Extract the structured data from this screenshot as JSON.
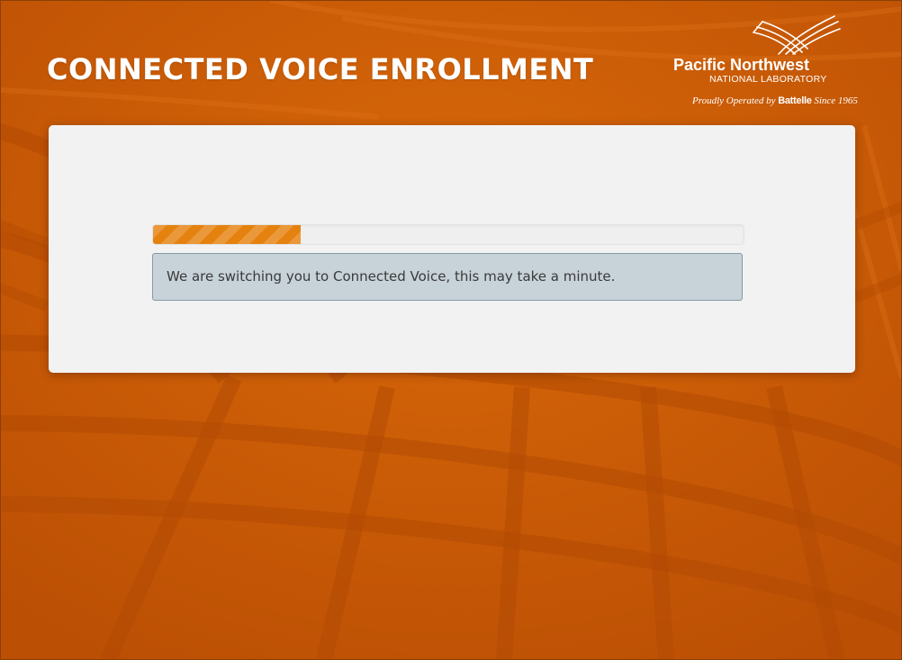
{
  "header": {
    "title": "CONNECTED VOICE ENROLLMENT"
  },
  "logo": {
    "name": "Pacific Northwest",
    "subtitle": "NATIONAL LABORATORY",
    "tagline_prefix": "Proudly Operated by ",
    "tagline_brand": "Battelle",
    "tagline_suffix": " Since 1965"
  },
  "progress": {
    "value": 0.25,
    "color": "#e5820f"
  },
  "status": {
    "message": "We are switching you to Connected Voice, this may take a minute."
  },
  "colors": {
    "background": "#c95a06",
    "panel": "#f2f2f2",
    "alert_bg": "#c8d2d9",
    "alert_border": "#8899a6"
  }
}
